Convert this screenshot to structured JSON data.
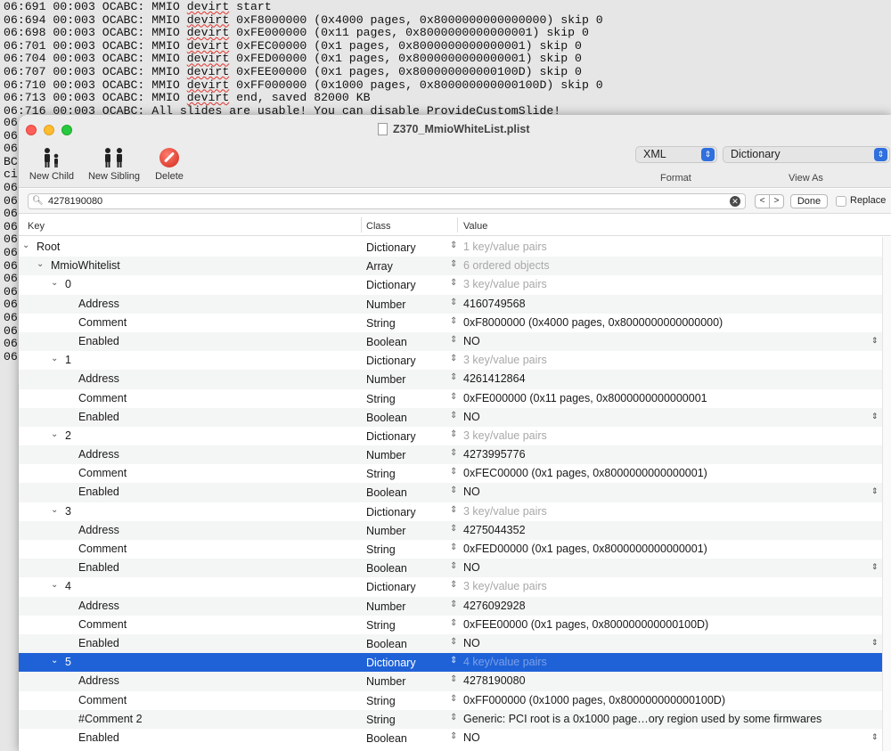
{
  "terminal": {
    "lines": [
      "06:691 00:003 OCABC: MMIO devirt start",
      "06:694 00:003 OCABC: MMIO devirt 0xF8000000 (0x4000 pages, 0x8000000000000000) skip 0",
      "06:698 00:003 OCABC: MMIO devirt 0xFE000000 (0x11 pages, 0x8000000000000001) skip 0",
      "06:701 00:003 OCABC: MMIO devirt 0xFEC00000 (0x1 pages, 0x8000000000000001) skip 0",
      "06:704 00:003 OCABC: MMIO devirt 0xFED00000 (0x1 pages, 0x8000000000000001) skip 0",
      "06:707 00:003 OCABC: MMIO devirt 0xFEE00000 (0x1 pages, 0x800000000000100D) skip 0",
      "06:710 00:003 OCABC: MMIO devirt 0xFF000000 (0x1000 pages, 0x800000000000100D) skip 0",
      "06:713 00:003 OCABC: MMIO devirt end, saved 82000 KB",
      "06:716 00:003 OCABC: All slides are usable! You can disable ProvideCustomSlide!"
    ],
    "left_fragments": [
      "06",
      "06",
      "06",
      "BC",
      "ci",
      "06",
      "06",
      "06",
      "06",
      "06",
      "06",
      "06",
      "06",
      "06",
      "06",
      "06",
      "06",
      "06",
      "06"
    ]
  },
  "window": {
    "title": "Z370_MmioWhiteList.plist"
  },
  "toolbar": {
    "new_child": "New Child",
    "new_sibling": "New Sibling",
    "delete": "Delete",
    "format_value": "XML",
    "format_label": "Format",
    "view_value": "Dictionary",
    "view_label": "View As"
  },
  "search": {
    "query": "4278190080",
    "done": "Done",
    "replace": "Replace"
  },
  "columns": {
    "key": "Key",
    "class": "Class",
    "value": "Value"
  },
  "rows": [
    {
      "key": "Root",
      "cls": "Dictionary",
      "val": "1 key/value pairs",
      "muted": true
    },
    {
      "key": "MmioWhitelist",
      "cls": "Array",
      "val": "6 ordered objects",
      "muted": true
    },
    {
      "key": "0",
      "cls": "Dictionary",
      "val": "3 key/value pairs",
      "muted": true
    },
    {
      "key": "Address",
      "cls": "Number",
      "val": "4160749568"
    },
    {
      "key": "Comment",
      "cls": "String",
      "val": "0xF8000000 (0x4000 pages, 0x8000000000000000)"
    },
    {
      "key": "Enabled",
      "cls": "Boolean",
      "val": "NO"
    },
    {
      "key": "1",
      "cls": "Dictionary",
      "val": "3 key/value pairs",
      "muted": true
    },
    {
      "key": "Address",
      "cls": "Number",
      "val": "4261412864"
    },
    {
      "key": "Comment",
      "cls": "String",
      "val": "0xFE000000 (0x11 pages, 0x8000000000000001"
    },
    {
      "key": "Enabled",
      "cls": "Boolean",
      "val": "NO"
    },
    {
      "key": "2",
      "cls": "Dictionary",
      "val": "3 key/value pairs",
      "muted": true
    },
    {
      "key": "Address",
      "cls": "Number",
      "val": "4273995776"
    },
    {
      "key": "Comment",
      "cls": "String",
      "val": "0xFEC00000 (0x1 pages, 0x8000000000000001)"
    },
    {
      "key": "Enabled",
      "cls": "Boolean",
      "val": "NO"
    },
    {
      "key": "3",
      "cls": "Dictionary",
      "val": "3 key/value pairs",
      "muted": true
    },
    {
      "key": "Address",
      "cls": "Number",
      "val": "4275044352"
    },
    {
      "key": "Comment",
      "cls": "String",
      "val": "0xFED00000 (0x1 pages, 0x8000000000000001)"
    },
    {
      "key": "Enabled",
      "cls": "Boolean",
      "val": "NO"
    },
    {
      "key": "4",
      "cls": "Dictionary",
      "val": "3 key/value pairs",
      "muted": true
    },
    {
      "key": "Address",
      "cls": "Number",
      "val": "4276092928"
    },
    {
      "key": "Comment",
      "cls": "String",
      "val": "0xFEE00000 (0x1 pages, 0x800000000000100D)"
    },
    {
      "key": "Enabled",
      "cls": "Boolean",
      "val": "NO"
    },
    {
      "key": "5",
      "cls": "Dictionary",
      "val": "4 key/value pairs",
      "muted": true
    },
    {
      "key": "Address",
      "cls": "Number",
      "val": "4278190080"
    },
    {
      "key": "Comment",
      "cls": "String",
      "val": "0xFF000000 (0x1000 pages, 0x800000000000100D)"
    },
    {
      "key": "#Comment 2",
      "cls": "String",
      "val": "Generic: PCI root is a 0x1000 page…ory region used by some firmwares"
    },
    {
      "key": "Enabled",
      "cls": "Boolean",
      "val": "NO"
    }
  ]
}
